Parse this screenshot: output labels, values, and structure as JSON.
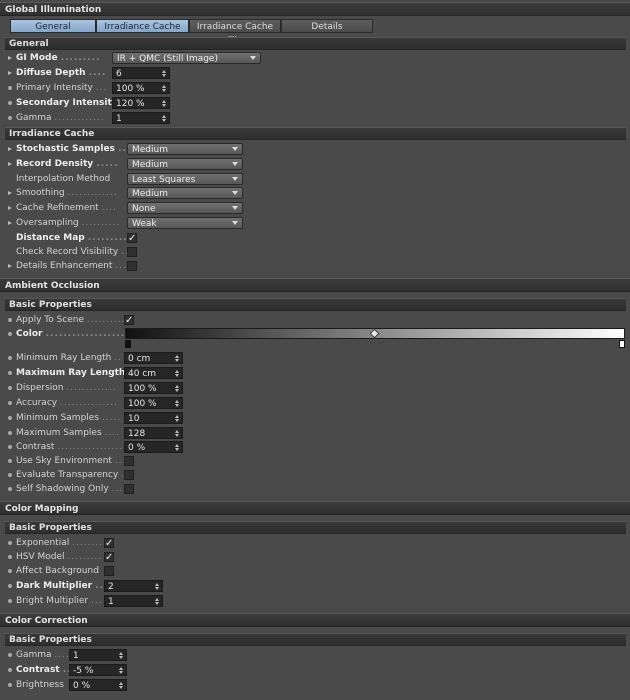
{
  "title": "Global Illumination",
  "tabs": [
    {
      "label": "General",
      "active": true
    },
    {
      "label": "Irradiance Cache",
      "active": true
    },
    {
      "label": "Irradiance Cache File",
      "active": false
    },
    {
      "label": "Details",
      "active": false
    }
  ],
  "sections": {
    "general": "General",
    "irradiance_cache": "Irradiance Cache",
    "ambient_occlusion": "Ambient Occlusion",
    "ao_basic": "Basic Properties",
    "color_mapping": "Color Mapping",
    "cm_basic": "Basic Properties",
    "color_correction": "Color Correction",
    "cc_basic": "Basic Properties"
  },
  "general": {
    "gi_mode": {
      "label": "GI Mode",
      "value": "IR + QMC (Still Image)"
    },
    "diffuse_depth": {
      "label": "Diffuse Depth",
      "value": "6"
    },
    "primary_intensity": {
      "label": "Primary Intensity",
      "value": "100 %"
    },
    "secondary_intensity": {
      "label": "Secondary Intensity",
      "value": "120 %"
    },
    "gamma": {
      "label": "Gamma",
      "value": "1"
    }
  },
  "irradiance": {
    "stochastic_samples": {
      "label": "Stochastic Samples",
      "value": "Medium"
    },
    "record_density": {
      "label": "Record Density",
      "value": "Medium"
    },
    "interpolation_method": {
      "label": "Interpolation Method",
      "value": "Least Squares"
    },
    "smoothing": {
      "label": "Smoothing",
      "value": "Medium"
    },
    "cache_refinement": {
      "label": "Cache Refinement",
      "value": "None"
    },
    "oversampling": {
      "label": "Oversampling",
      "value": "Weak"
    },
    "distance_map": {
      "label": "Distance Map",
      "checked": true
    },
    "check_record_visibility": {
      "label": "Check Record Visibility",
      "checked": false
    },
    "details_enhancement": {
      "label": "Details Enhancement",
      "checked": false
    }
  },
  "ao": {
    "apply_to_scene": {
      "label": "Apply To Scene",
      "checked": true
    },
    "color": {
      "label": "Color"
    },
    "min_ray_length": {
      "label": "Minimum Ray Length",
      "value": "0 cm"
    },
    "max_ray_length": {
      "label": "Maximum Ray Length",
      "value": "40 cm"
    },
    "dispersion": {
      "label": "Dispersion",
      "value": "100 %"
    },
    "accuracy": {
      "label": "Accuracy",
      "value": "100 %"
    },
    "min_samples": {
      "label": "Minimum Samples",
      "value": "10"
    },
    "max_samples": {
      "label": "Maximum Samples",
      "value": "128"
    },
    "contrast": {
      "label": "Contrast",
      "value": "0 %"
    },
    "use_sky": {
      "label": "Use Sky Environment",
      "checked": false
    },
    "eval_transparency": {
      "label": "Evaluate Transparency",
      "checked": false
    },
    "self_shadowing": {
      "label": "Self Shadowing Only",
      "checked": false
    }
  },
  "cm": {
    "exponential": {
      "label": "Exponential",
      "checked": true
    },
    "hsv_model": {
      "label": "HSV Model",
      "checked": true
    },
    "affect_background": {
      "label": "Affect Background",
      "checked": false
    },
    "dark_multiplier": {
      "label": "Dark Multiplier",
      "value": "2"
    },
    "bright_multiplier": {
      "label": "Bright Multiplier",
      "value": "1"
    }
  },
  "cc": {
    "gamma": {
      "label": "Gamma",
      "value": "1"
    },
    "contrast": {
      "label": "Contrast",
      "value": "-5 %"
    },
    "brightness": {
      "label": "Brightness",
      "value": "0 %"
    }
  },
  "check_glyph": "✓"
}
